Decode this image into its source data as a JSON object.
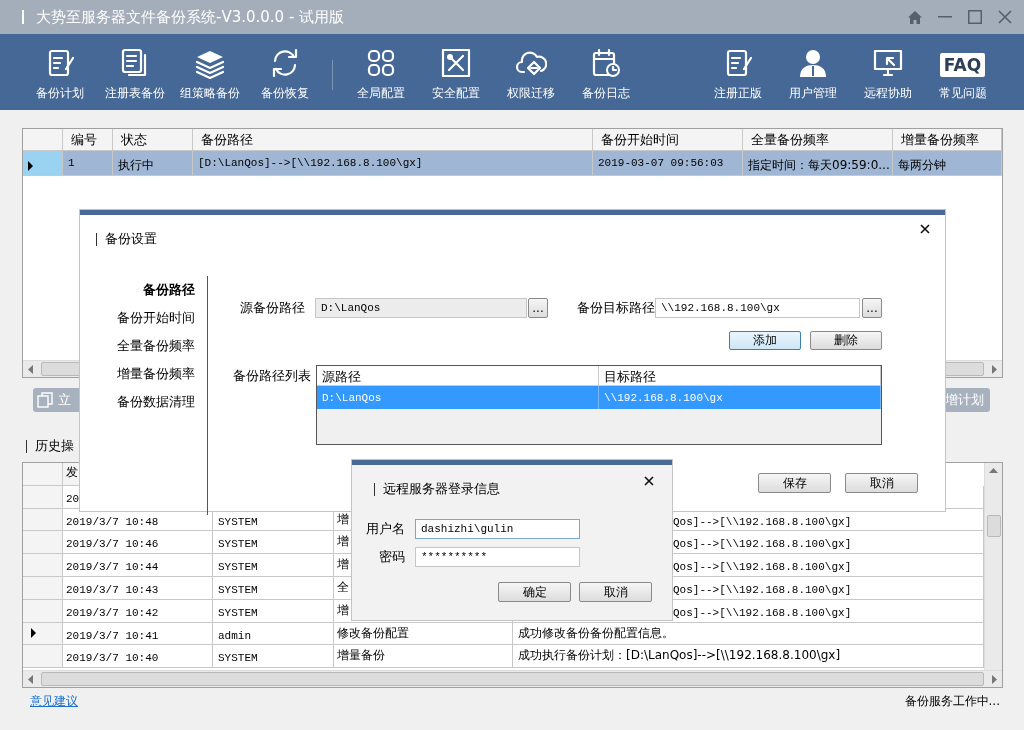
{
  "window": {
    "title": "大势至服务器文件备份系统-V3.0.0.0 - 试用版"
  },
  "toolbar": {
    "left": [
      {
        "label": "备份计划"
      },
      {
        "label": "注册表备份"
      },
      {
        "label": "组策略备份"
      },
      {
        "label": "备份恢复"
      },
      {
        "label": "全局配置"
      },
      {
        "label": "安全配置"
      },
      {
        "label": "权限迁移"
      },
      {
        "label": "备份日志"
      }
    ],
    "right": [
      {
        "label": "注册正版"
      },
      {
        "label": "用户管理"
      },
      {
        "label": "远程协助"
      },
      {
        "label": "常见问题",
        "badge": "FAQ"
      }
    ]
  },
  "plans": {
    "columns": [
      "编号",
      "状态",
      "备份路径",
      "备份开始时间",
      "全量备份频率",
      "增量备份频率"
    ],
    "rows": [
      {
        "selected": true,
        "cells": [
          "1",
          "执行中",
          "[D:\\LanQos]-->[\\\\192.168.8.100\\gx]",
          "2019-03-07 09:56:03",
          "指定时间：每天09:59:0...",
          "每两分钟"
        ]
      }
    ]
  },
  "actions": [
    {
      "label": "立"
    },
    {
      "label": "增计划"
    }
  ],
  "history": {
    "title": "历史操",
    "columns": [
      "发"
    ],
    "rows": [
      {
        "kind": "covered",
        "selected": false,
        "cells": [
          "20"
        ]
      },
      {
        "kind": "covered",
        "selected": false,
        "cells": [
          "2019/3/7 10:48",
          "SYSTEM",
          "增",
          "Qos]-->[\\\\192.168.8.100\\gx]"
        ]
      },
      {
        "kind": "covered",
        "selected": false,
        "cells": [
          "2019/3/7 10:46",
          "SYSTEM",
          "增",
          "Qos]-->[\\\\192.168.8.100\\gx]"
        ]
      },
      {
        "kind": "covered",
        "selected": false,
        "cells": [
          "2019/3/7 10:44",
          "SYSTEM",
          "增",
          "Qos]-->[\\\\192.168.8.100\\gx]"
        ]
      },
      {
        "kind": "covered",
        "selected": false,
        "cells": [
          "2019/3/7 10:43",
          "SYSTEM",
          "全",
          "Qos]-->[\\\\192.168.8.100\\gx]"
        ]
      },
      {
        "kind": "covered",
        "selected": false,
        "cells": [
          "2019/3/7 10:42",
          "SYSTEM",
          "增",
          "Qos]-->[\\\\192.168.8.100\\gx]"
        ]
      },
      {
        "kind": "full",
        "selected": true,
        "cells": [
          "2019/3/7 10:41",
          "admin",
          "修改备份配置",
          "成功修改备份备份配置信息。"
        ]
      },
      {
        "kind": "full",
        "selected": false,
        "cells": [
          "2019/3/7 10:40",
          "SYSTEM",
          "增量备份",
          "成功执行备份计划：[D:\\LanQos]-->[\\\\192.168.8.100\\gx]"
        ]
      }
    ]
  },
  "footer": {
    "link": "意见建议",
    "status": "备份服务工作中..."
  },
  "settings_dialog": {
    "title": "备份设置",
    "nav": [
      {
        "label": "备份路径",
        "selected": true
      },
      {
        "label": "备份开始时间",
        "selected": false
      },
      {
        "label": "全量备份频率",
        "selected": false
      },
      {
        "label": "增量备份频率",
        "selected": false
      },
      {
        "label": "备份数据清理",
        "selected": false
      }
    ],
    "source_label": "源备份路径",
    "source_value": "D:\\LanQos",
    "source_browse": "...",
    "target_label": "备份目标路径",
    "target_value": "\\\\192.168.8.100\\gx",
    "target_browse": "...",
    "buttons": [
      {
        "label": "添加",
        "focused": true
      },
      {
        "label": "删除",
        "focused": false
      }
    ],
    "list_label": "备份路径列表",
    "list": {
      "columns": [
        "源路径",
        "目标路径"
      ],
      "rows": [
        {
          "selected": true,
          "cells": [
            "D:\\LanQos",
            "\\\\192.168.8.100\\gx"
          ]
        }
      ]
    },
    "footer_buttons": [
      {
        "label": "保存"
      },
      {
        "label": "取消"
      }
    ]
  },
  "login_dialog": {
    "title": "远程服务器登录信息",
    "fields": [
      {
        "label": "用户名",
        "value": "dashizhi\\gulin",
        "focused": true
      },
      {
        "label": "密码",
        "value": "**********",
        "focused": false
      }
    ],
    "buttons": [
      {
        "label": "确定"
      },
      {
        "label": "取消"
      }
    ]
  }
}
